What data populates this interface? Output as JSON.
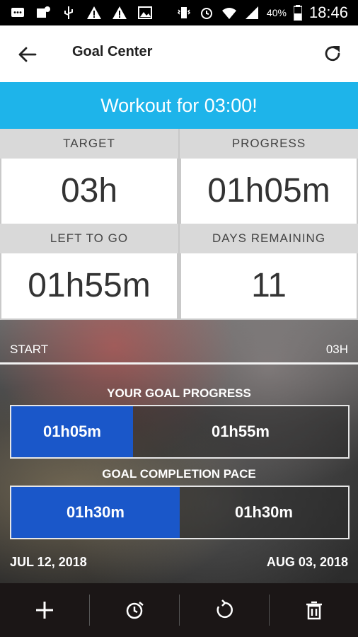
{
  "status_bar": {
    "battery_percent": "40%",
    "time": "18:46",
    "icons": [
      "message-icon",
      "notification-icon",
      "usb-icon",
      "warning-icon",
      "warning-icon",
      "image-icon",
      "vibrate-icon",
      "alarm-icon",
      "wifi-icon",
      "signal-icon",
      "battery-icon"
    ]
  },
  "app_bar": {
    "title": "Goal Center",
    "back_icon": "arrow-left-icon",
    "refresh_icon": "refresh-icon"
  },
  "banner": {
    "text": "Workout for 03:00!"
  },
  "stats": {
    "target_label": "TARGET",
    "target_value": "03h",
    "progress_label": "PROGRESS",
    "progress_value": "01h05m",
    "left_label": "LEFT TO GO",
    "left_value": "01h55m",
    "days_label": "DAYS REMAINING",
    "days_value": "11"
  },
  "hero": {
    "start_label": "START",
    "end_label": "03H",
    "goal_progress_title": "YOUR GOAL PROGRESS",
    "goal_progress_done": "01h05m",
    "goal_progress_left": "01h55m",
    "goal_progress_fraction": 0.3611,
    "pace_title": "GOAL COMPLETION PACE",
    "pace_done": "01h30m",
    "pace_left": "01h30m",
    "pace_fraction": 0.5,
    "start_date": "JUL 12, 2018",
    "end_date": "AUG 03, 2018"
  },
  "toolbar": {
    "items": [
      "add-icon",
      "timer-icon",
      "reset-icon",
      "trash-icon"
    ]
  },
  "colors": {
    "accent_blue": "#1eb4ea",
    "progress_fill": "#1a57c9",
    "toolbar_bg": "#1b1616"
  }
}
